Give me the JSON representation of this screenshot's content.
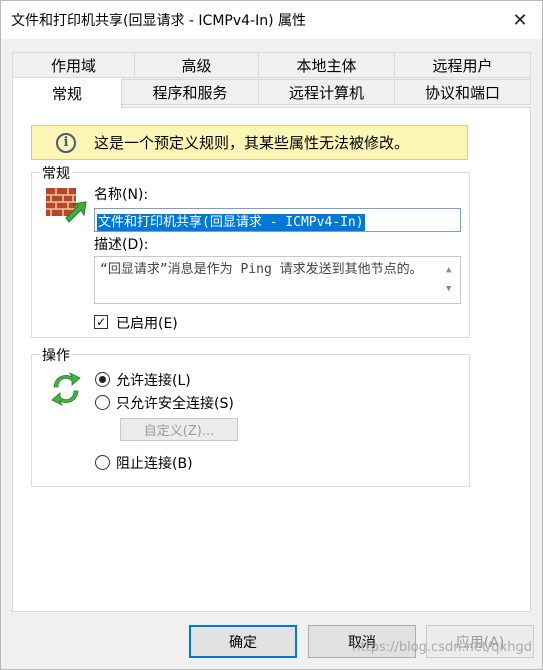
{
  "window": {
    "title": "文件和打印机共享(回显请求 - ICMPv4-In) 属性",
    "close_glyph": "✕"
  },
  "tabs": {
    "row1": [
      "作用域",
      "高级",
      "本地主体",
      "远程用户"
    ],
    "row2": [
      "常规",
      "程序和服务",
      "远程计算机",
      "协议和端口"
    ]
  },
  "info": {
    "icon": "i",
    "message": "这是一个预定义规则，其某些属性无法被修改。"
  },
  "general": {
    "group_label": "常规",
    "name_label": "名称(N):",
    "name_value": "文件和打印机共享(回显请求 - ICMPv4-In)",
    "desc_label": "描述(D):",
    "desc_value": "“回显请求”消息是作为 Ping 请求发送到其他节点的。",
    "enabled_label": "已启用(E)",
    "enabled": true
  },
  "action": {
    "group_label": "操作",
    "allow_label": "允许连接(L)",
    "allow_secure_label": "只允许安全连接(S)",
    "customize_label": "自定义(Z)...",
    "block_label": "阻止连接(B)",
    "selected": "allow"
  },
  "buttons": {
    "ok": "确定",
    "cancel": "取消",
    "apply": "应用(A)"
  },
  "watermark": "https://blog.csdn.net/qxhgd"
}
